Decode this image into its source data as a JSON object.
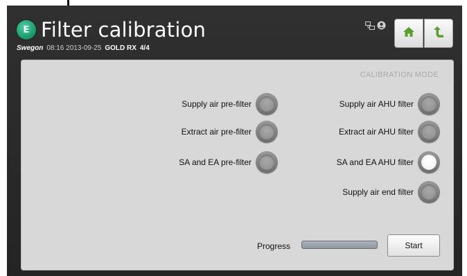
{
  "header": {
    "logo_letter": "E",
    "title": "Filter calibration",
    "brand": "Swegon",
    "time": "08:16",
    "date": "2013-09-25",
    "unit": "GOLD RX",
    "page": "4/4"
  },
  "status_icons": [
    "network-icon",
    "user-icon"
  ],
  "nav": {
    "home_icon": "home-icon",
    "back_icon": "back-arrow-icon"
  },
  "panel": {
    "mode_label": "CALIBRATION MODE",
    "left_filters": [
      {
        "label": "Supply air pre-filter",
        "selected": false
      },
      {
        "label": "Extract air pre-filter",
        "selected": false
      },
      {
        "label": "SA and EA pre-filter",
        "selected": false
      }
    ],
    "right_filters": [
      {
        "label": "Supply air AHU filter",
        "selected": false
      },
      {
        "label": "Extract air AHU filter",
        "selected": false
      },
      {
        "label": "SA and EA AHU filter",
        "selected": true
      },
      {
        "label": "Supply air end filter",
        "selected": false
      }
    ],
    "progress_label": "Progress",
    "progress_value": 0,
    "start_label": "Start"
  },
  "colors": {
    "accent": "#1a9e6e",
    "home_icon": "#5aa02c",
    "back_icon": "#5aa02c",
    "background": "#2a2a2a",
    "panel": "#d8d8d8"
  }
}
